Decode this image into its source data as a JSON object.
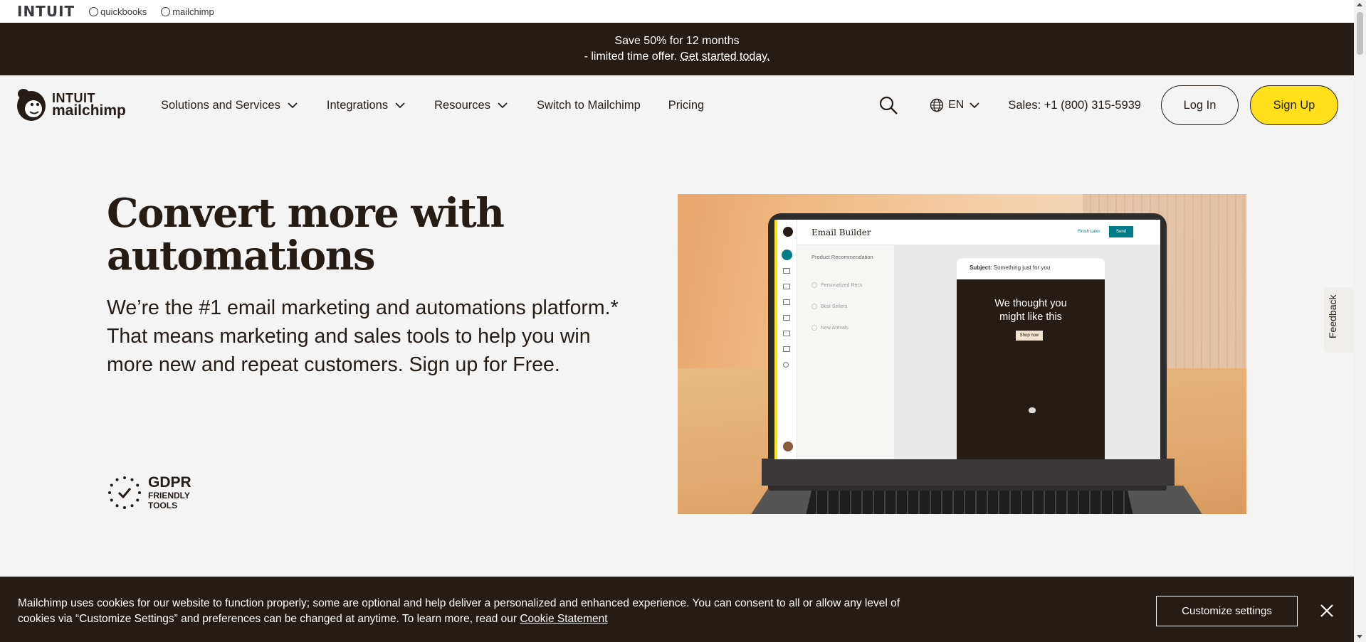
{
  "intuit_bar": {
    "logo": "INTUIT",
    "brands": [
      "quickbooks",
      "mailchimp"
    ]
  },
  "promo": {
    "line1": "Save 50% for 12 months",
    "line2": "- limited time offer.",
    "link": "Get started today."
  },
  "nav": {
    "logo_top": "INTUIT",
    "logo_bottom": "mailchimp",
    "items": [
      {
        "label": "Solutions and Services",
        "dropdown": true
      },
      {
        "label": "Integrations",
        "dropdown": true
      },
      {
        "label": "Resources",
        "dropdown": true
      },
      {
        "label": "Switch to Mailchimp",
        "dropdown": false
      },
      {
        "label": "Pricing",
        "dropdown": false
      }
    ],
    "language": "EN",
    "sales": "Sales: +1 (800) 315-5939",
    "login": "Log In",
    "signup": "Sign Up"
  },
  "hero": {
    "title_line1": "Convert more with",
    "title_line2": "automations",
    "subtitle": "We’re the #1 email marketing and automations platform.* That means marketing and sales tools to help you win more new and repeat customers. Sign up for Free.",
    "gdpr_title": "GDPR",
    "gdpr_line1": "FRIENDLY",
    "gdpr_line2": "TOOLS"
  },
  "mockup": {
    "title": "Email Builder",
    "finish_later": "Finish Later",
    "send": "Send",
    "panel_heading": "Product Recommendation",
    "options": [
      "Personalized Recs",
      "Best Sellers",
      "New Arrivals"
    ],
    "subject_label": "Subject:",
    "subject_value": "Something just for you",
    "email_line1": "We thought you",
    "email_line2": "might like this",
    "shop_now": "Shop now"
  },
  "feedback": "Feedback",
  "cookie": {
    "text_line1": "Mailchimp uses cookies for our website to function properly; some are optional and help deliver a personalized and enhanced experience. You can consent to all or allow any level of",
    "text_line2": "cookies via “Customize Settings” and preferences can be changed at anytime. To learn more, read our",
    "link": "Cookie Statement",
    "customize": "Customize settings"
  },
  "colors": {
    "dark": "#241c15",
    "yellow": "#ffe01b",
    "background": "#f4f4f4",
    "teal": "#007c89"
  }
}
